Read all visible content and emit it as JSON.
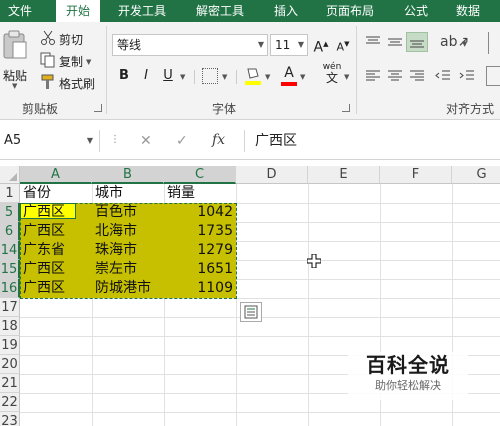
{
  "tabs": [
    "文件",
    "开始",
    "开发工具",
    "解密工具",
    "插入",
    "页面布局",
    "公式",
    "数据"
  ],
  "ribbon": {
    "clipboard": {
      "paste": "粘贴",
      "cut": "剪切",
      "copy": "复制",
      "format_painter": "格式刷",
      "group_label": "剪贴板"
    },
    "font": {
      "font_name": "等线",
      "font_size": "11",
      "grow": "A",
      "shrink": "A",
      "bold": "B",
      "italic": "I",
      "underline": "U",
      "wen": "wén",
      "wen_char": "文",
      "group_label": "字体",
      "fill_color": "#ffff00",
      "font_color": "#ff0000"
    },
    "alignment": {
      "group_label": "对齐方式"
    }
  },
  "formula_bar": {
    "name_box": "A5",
    "cancel": "✕",
    "confirm": "✓",
    "fx": "fx",
    "content": "广西区"
  },
  "sheet": {
    "columns": [
      "A",
      "B",
      "C",
      "D",
      "E",
      "F",
      "G"
    ],
    "row_headers": [
      "1",
      "5",
      "6",
      "14",
      "15",
      "16",
      "17",
      "18",
      "19",
      "20",
      "21",
      "22",
      "23"
    ],
    "header_row": [
      "省份",
      "城市",
      "销量"
    ],
    "rows": [
      [
        "广西区",
        "百色市",
        "1042"
      ],
      [
        "广西区",
        "北海市",
        "1735"
      ],
      [
        "广东省",
        "珠海市",
        "1279"
      ],
      [
        "广西区",
        "崇左市",
        "1651"
      ],
      [
        "广西区",
        "防城港市",
        "1109"
      ]
    ],
    "highlight_color": "#c6c000"
  },
  "watermark": {
    "main": "百科全说",
    "sub": "助你轻松解决"
  }
}
